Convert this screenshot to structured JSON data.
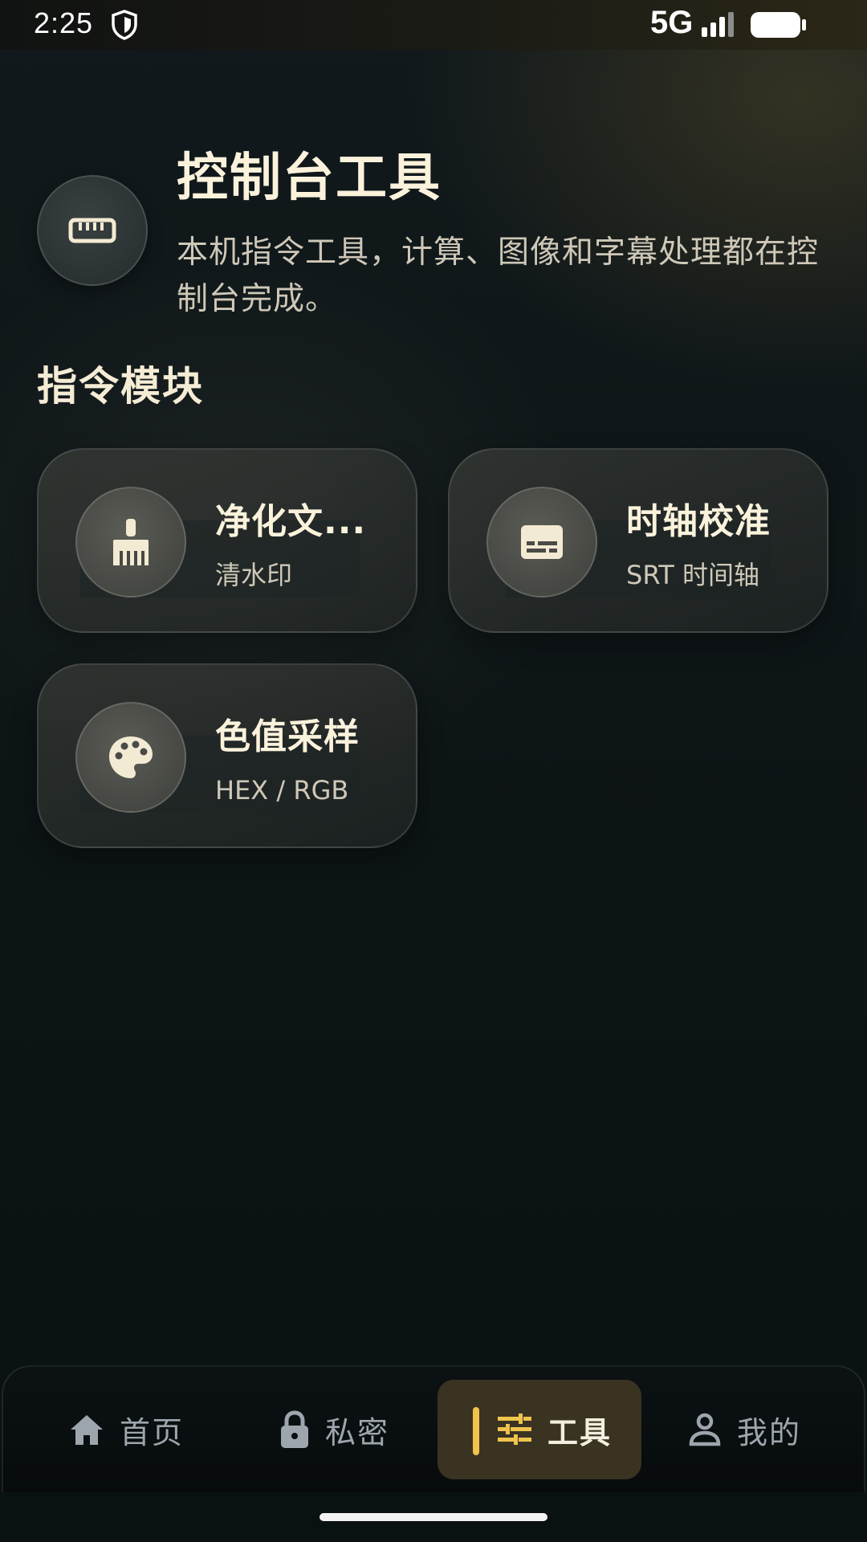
{
  "status_bar": {
    "time": "2:25",
    "network": "5G",
    "icons": [
      "shield-icon",
      "signal-icon",
      "battery-icon"
    ]
  },
  "header": {
    "icon": "ruler-icon",
    "title": "控制台工具",
    "subtitle": "本机指令工具，计算、图像和字幕处理都在控制台完成。"
  },
  "section": {
    "title": "指令模块"
  },
  "cards": [
    {
      "icon": "broom-icon",
      "title": "净化文...",
      "subtitle": "清水印"
    },
    {
      "icon": "subtitles-icon",
      "title": "时轴校准",
      "subtitle": "SRT 时间轴"
    },
    {
      "icon": "palette-icon",
      "title": "色值采样",
      "subtitle": "HEX / RGB"
    }
  ],
  "bottom_nav": {
    "items": [
      {
        "icon": "home-icon",
        "label": "首页",
        "active": false
      },
      {
        "icon": "lock-icon",
        "label": "私密",
        "active": false
      },
      {
        "icon": "sliders-icon",
        "label": "工具",
        "active": true
      },
      {
        "icon": "person-icon",
        "label": "我的",
        "active": false
      }
    ]
  },
  "colors": {
    "accent": "#f0c44c",
    "title_text": "#fbf2dc",
    "secondary_text": "#cfc8b8",
    "nav_inactive": "#9ea6ad",
    "nav_active_bg": "#3a3322"
  }
}
